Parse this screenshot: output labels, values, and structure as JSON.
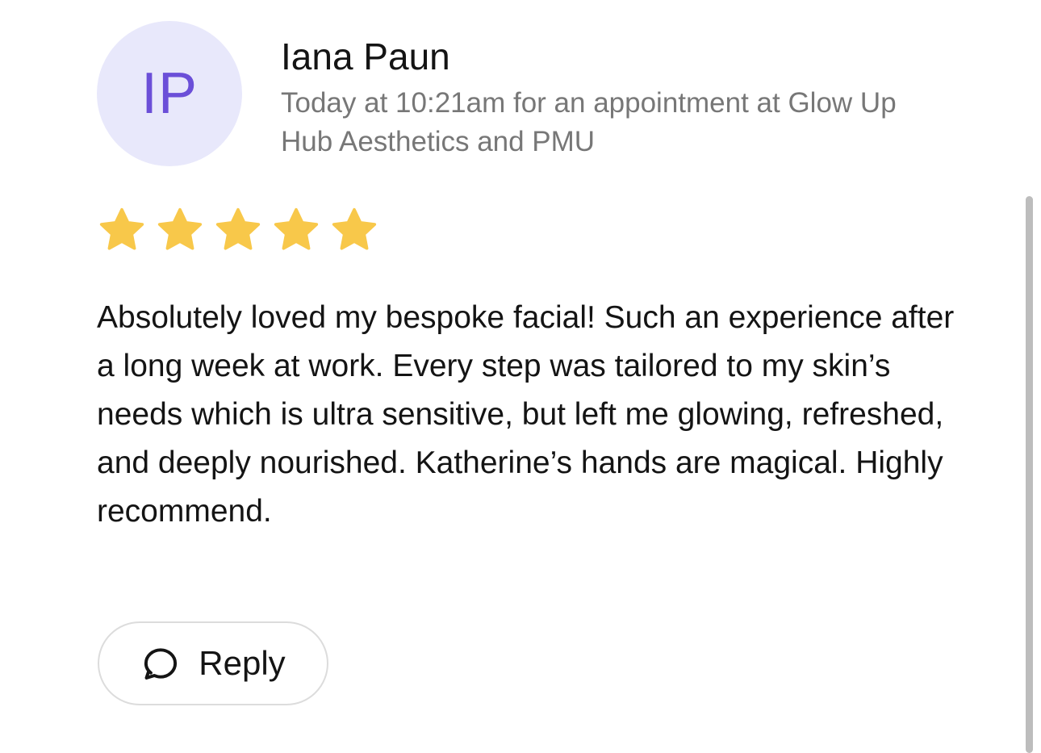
{
  "reviewer": {
    "initials": "IP",
    "name": "Iana Paun",
    "meta": "Today at 10:21am for an appointment at Glow Up Hub Aesthetics and PMU"
  },
  "rating": {
    "value": 5,
    "max": 5,
    "star_color": "#F8C84A"
  },
  "review": {
    "text": "Absolutely loved my bespoke facial! Such an experience after a long week at work. Every step was tailored to my skin’s needs which is ultra sensitive, but left me glowing, refreshed, and deeply nourished. Katherine’s hands are magical. Highly recommend."
  },
  "actions": {
    "reply_label": "Reply",
    "reply_icon": "speech-bubble-icon"
  },
  "colors": {
    "avatar_background": "#E8E8FB",
    "avatar_text": "#6B4FD8",
    "meta_text": "#777777"
  }
}
